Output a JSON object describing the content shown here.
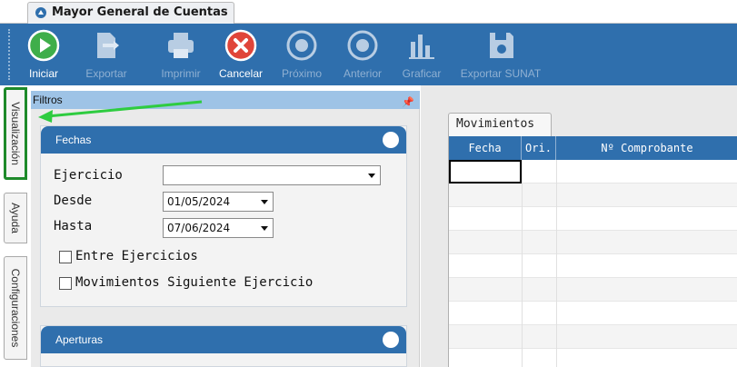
{
  "window": {
    "tab_title": "Mayor General de Cuentas"
  },
  "toolbar": {
    "buttons": [
      {
        "label": "Iniciar",
        "icon": "play-icon",
        "enabled": true
      },
      {
        "label": "Exportar",
        "icon": "export-icon",
        "enabled": false
      },
      {
        "label": "Imprimir",
        "icon": "printer-icon",
        "enabled": false
      },
      {
        "label": "Cancelar",
        "icon": "cancel-icon",
        "enabled": true
      },
      {
        "label": "Próximo",
        "icon": "next-icon",
        "enabled": false
      },
      {
        "label": "Anterior",
        "icon": "previous-icon",
        "enabled": false
      },
      {
        "label": "Graficar",
        "icon": "chart-icon",
        "enabled": false
      },
      {
        "label": "Exportar SUNAT",
        "icon": "save-disk-icon",
        "enabled": false
      }
    ]
  },
  "side_tabs": [
    {
      "label": "Visualización",
      "active": true
    },
    {
      "label": "Ayuda",
      "active": false
    },
    {
      "label": "Configuraciones",
      "active": false
    }
  ],
  "filters": {
    "header": "Filtros",
    "fechas": {
      "title": "Fechas",
      "ejercicio_label": "Ejercicio",
      "ejercicio_value": "",
      "desde_label": "Desde",
      "desde_value": "01/05/2024",
      "hasta_label": "Hasta",
      "hasta_value": "07/06/2024",
      "entre_ejercicios_label": "Entre Ejercicios",
      "entre_ejercicios_checked": false,
      "siguiente_label": "Movimientos Siguiente Ejercicio",
      "siguiente_checked": false
    },
    "aperturas": {
      "title": "Aperturas"
    }
  },
  "results": {
    "tab_label": "Movimientos",
    "columns": [
      "Fecha",
      "Ori.",
      "Nº Comprobante"
    ]
  },
  "colors": {
    "ribbon": "#2f6fad",
    "filters_header": "#9ec3e6",
    "annotation": "#1e8a2a"
  }
}
